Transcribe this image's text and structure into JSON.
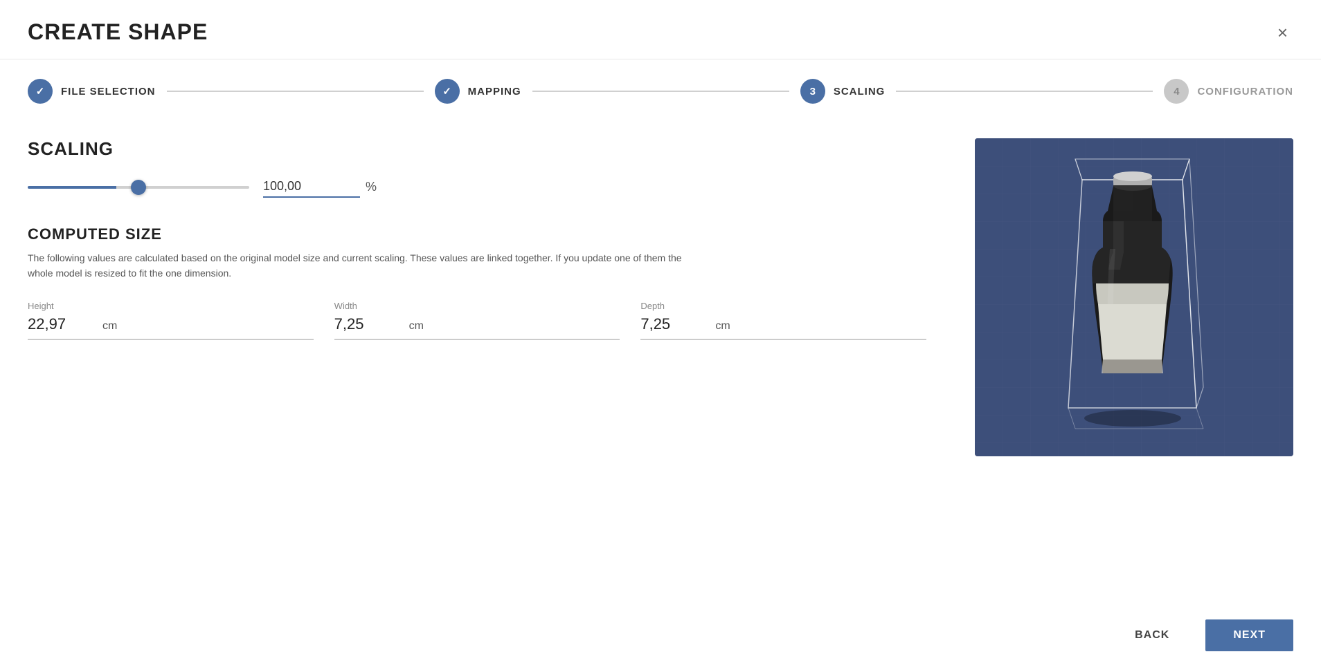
{
  "modal": {
    "title": "CREATE SHAPE",
    "close_label": "×"
  },
  "stepper": {
    "steps": [
      {
        "id": "file-selection",
        "label": "FILE SELECTION",
        "state": "completed",
        "number": "✓"
      },
      {
        "id": "mapping",
        "label": "MAPPING",
        "state": "completed",
        "number": "✓"
      },
      {
        "id": "scaling",
        "label": "SCALING",
        "state": "active",
        "number": "3"
      },
      {
        "id": "configuration",
        "label": "CONFIGURATION",
        "state": "inactive",
        "number": "4"
      }
    ]
  },
  "scaling": {
    "title": "SCALING",
    "slider_value": 100,
    "slider_min": 0,
    "slider_max": 200,
    "input_value": "100,00",
    "unit": "%"
  },
  "computed_size": {
    "title": "COMPUTED SIZE",
    "description": "The following values are calculated based on the original model size and current scaling. These values are linked together. If you update one of them the whole model is resized to fit the one dimension.",
    "fields": [
      {
        "label": "Height",
        "value": "22,97",
        "unit": "cm"
      },
      {
        "label": "Width",
        "value": "7,25",
        "unit": "cm"
      },
      {
        "label": "Depth",
        "value": "7,25",
        "unit": "cm"
      }
    ]
  },
  "footer": {
    "back_label": "BACK",
    "next_label": "NEXT"
  },
  "colors": {
    "accent": "#4a6fa5",
    "preview_bg": "#3d4f7a"
  }
}
